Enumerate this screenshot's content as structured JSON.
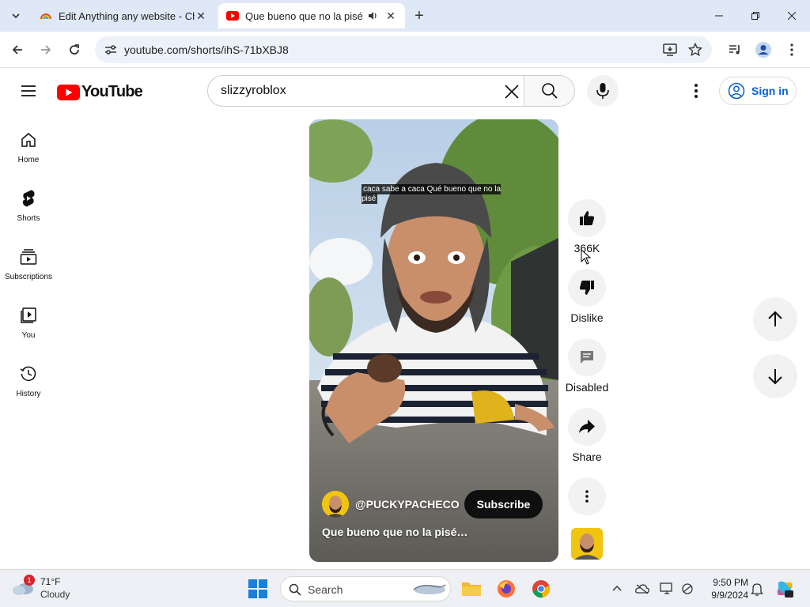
{
  "browser": {
    "tabs": [
      {
        "title": "Edit Anything any website - Ch",
        "active": false
      },
      {
        "title": "Que bueno que no la pisé",
        "active": true
      }
    ],
    "url": "youtube.com/shorts/ihS-71bXBJ8"
  },
  "youtube": {
    "logo_text": "YouTube",
    "search_query": "slizzyroblox",
    "sign_in_label": "Sign in",
    "sidebar": [
      {
        "label": "Home",
        "icon": "home-icon"
      },
      {
        "label": "Shorts",
        "icon": "shorts-icon"
      },
      {
        "label": "Subscriptions",
        "icon": "subscriptions-icon"
      },
      {
        "label": "You",
        "icon": "you-icon"
      },
      {
        "label": "History",
        "icon": "history-icon"
      }
    ],
    "short": {
      "caption": "caca sabe a caca Qué bueno que no la pisé",
      "channel": "@PUCKYPACHECO",
      "subscribe_label": "Subscribe",
      "title": "Que bueno que no la pisé…"
    },
    "actions": {
      "likes": "366K",
      "dislike_label": "Dislike",
      "comments_label": "Disabled",
      "share_label": "Share"
    }
  },
  "taskbar": {
    "weather_temp": "71°F",
    "weather_cond": "Cloudy",
    "weather_badge": "1",
    "search_label": "Search",
    "time": "9:50 PM",
    "date": "9/9/2024"
  },
  "colors": {
    "youtube_red": "#ff0000",
    "signin_blue": "#065fd4",
    "tabstrip": "#dfe8f6"
  }
}
